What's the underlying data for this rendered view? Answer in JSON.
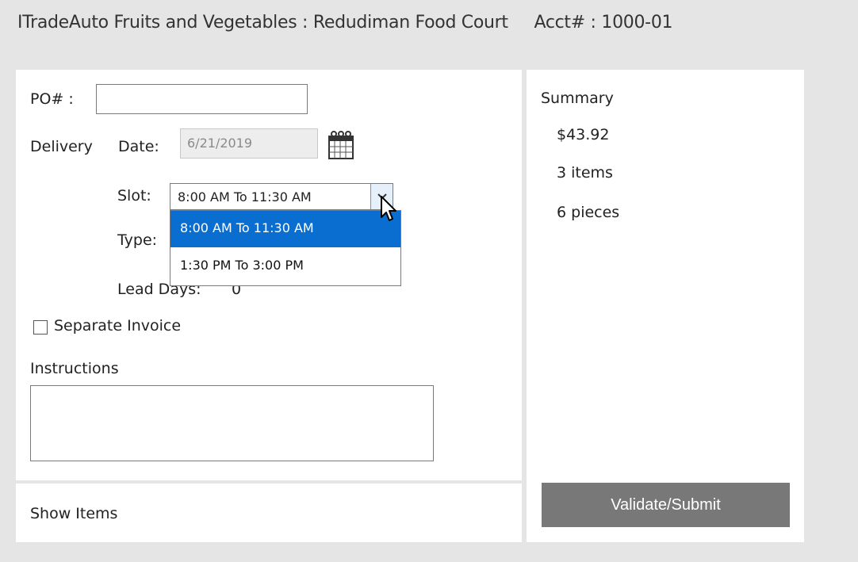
{
  "header": {
    "vendor": "ITradeAuto Fruits and Vegetables :",
    "location": "Redudiman Food Court",
    "acct_label": "Acct# :",
    "acct_value": "1000-01"
  },
  "form": {
    "po_label": "PO# :",
    "po_value": "",
    "delivery_label": "Delivery",
    "date_label": "Date:",
    "date_value": "6/21/2019",
    "slot_label": "Slot:",
    "slot_selected": "8:00 AM To 11:30 AM",
    "slot_options": [
      "8:00 AM To 11:30 AM",
      "1:30 PM To 3:00 PM"
    ],
    "type_label": "Type:",
    "lead_days_label": "Lead Days:",
    "lead_days_value": "0",
    "separate_invoice_label": "Separate Invoice",
    "separate_invoice_checked": false,
    "instructions_label": "Instructions",
    "instructions_value": ""
  },
  "bottom": {
    "show_items_label": "Show Items"
  },
  "summary": {
    "title": "Summary",
    "total": "$43.92",
    "items": "3 items",
    "pieces": "6 pieces",
    "submit_label": "Validate/Submit"
  },
  "colors": {
    "highlight": "#0a6ed1",
    "button": "#787878",
    "background": "#e5e5e5"
  },
  "icons": {
    "date_picker": "calendar-icon",
    "slot_dropdown": "chevron-down-icon",
    "pointer": "mouse-cursor-icon"
  }
}
